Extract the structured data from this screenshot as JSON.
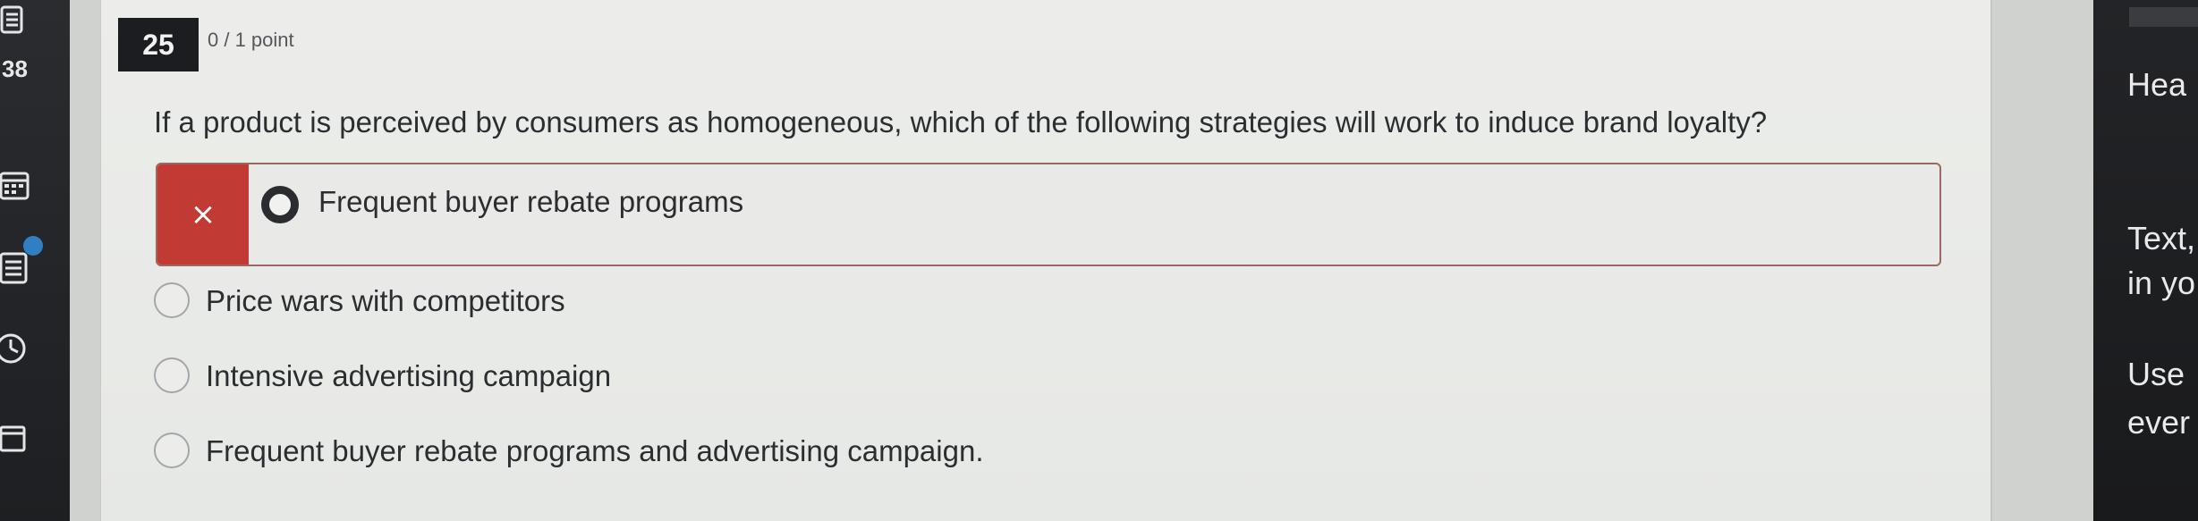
{
  "question": {
    "number": "25",
    "points": "0 / 1 point",
    "text": "If a product is perceived by consumers as homogeneous, which of the following strategies will work to induce brand loyalty?"
  },
  "selected_answer": {
    "status_icon": "×",
    "text": "Frequent buyer rebate programs",
    "correct": false
  },
  "options": [
    {
      "text": "Price wars with competitors"
    },
    {
      "text": "Intensive advertising campaign"
    },
    {
      "text": "Frequent buyer rebate programs and advertising campaign."
    }
  ],
  "nav": {
    "badge": "38"
  },
  "right_sidebar": {
    "heading": "Hea",
    "line1": "Text,",
    "line2": "in yo",
    "line3": "Use",
    "line4": "ever"
  },
  "colors": {
    "incorrect_flag": "#c23a34",
    "incorrect_border": "#9a6a62",
    "panel_bg": "#ecedea",
    "nav_bg": "#232427"
  },
  "icons": [
    "menu-icon",
    "calendar-icon",
    "list-icon",
    "clock-icon",
    "folder-icon",
    "close-icon",
    "radio-selected-icon",
    "radio-empty-icon"
  ]
}
